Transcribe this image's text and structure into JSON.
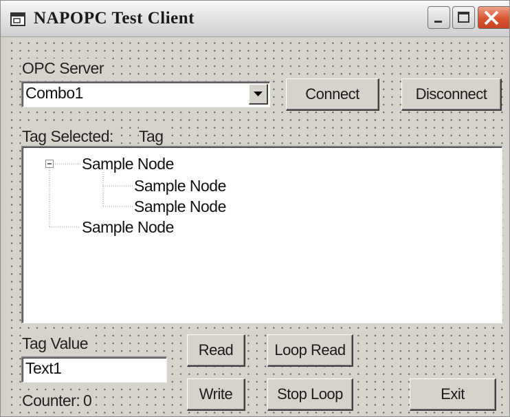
{
  "window": {
    "title": "NAPOPC Test Client",
    "icon": "app-window-icon",
    "controls": [
      "minimize-icon",
      "maximize-icon",
      "close-icon"
    ]
  },
  "server": {
    "label": "OPC Server",
    "combo_value": "Combo1",
    "connect_label": "Connect",
    "disconnect_label": "Disconnect"
  },
  "tag": {
    "selected_label": "Tag Selected:",
    "selected_value": "Tag"
  },
  "tree": {
    "root": "Sample Node",
    "child_1": "Sample Node",
    "child_2": "Sample Node",
    "sibling": "Sample Node",
    "expander": "minus-box-icon"
  },
  "value": {
    "label": "Tag Value",
    "text": "Text1",
    "counter_label": "Counter:",
    "counter_value": "0"
  },
  "buttons": {
    "read": "Read",
    "write": "Write",
    "loop_read": "Loop Read",
    "stop_loop": "Stop Loop",
    "exit": "Exit"
  },
  "colors": {
    "form_face": "#d6d3cc",
    "close_button": "#d9532f"
  }
}
